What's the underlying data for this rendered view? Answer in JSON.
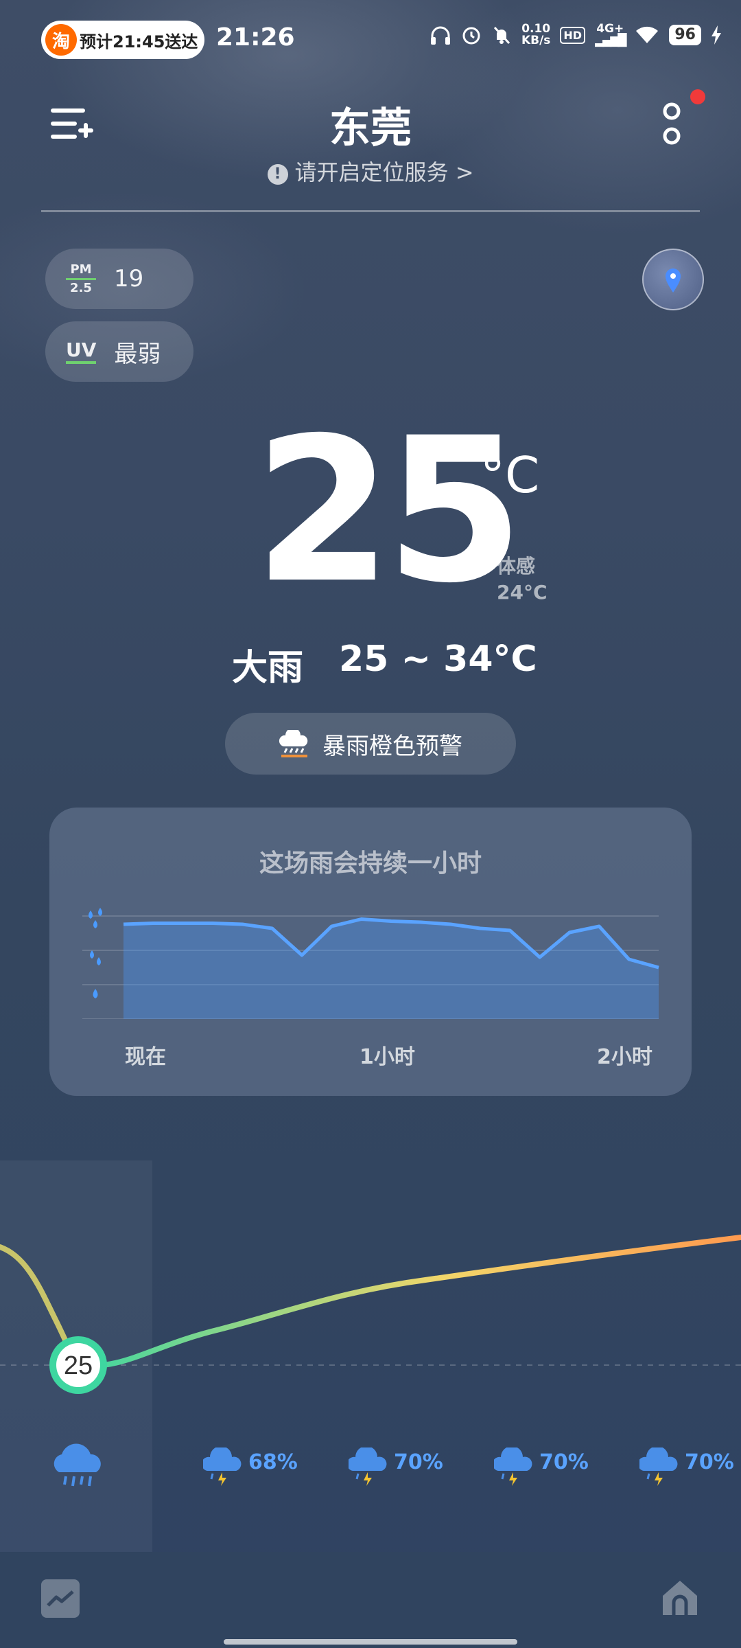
{
  "status_bar": {
    "order_pill_icon": "淘",
    "order_pill_text": "预计21:45送达",
    "time": "21:26",
    "net_speed_value": "0.10",
    "net_speed_unit": "KB/s",
    "hd_badge": "HD",
    "network": "4G+",
    "battery": "96",
    "icons": [
      "headphones-icon",
      "alarm-icon",
      "mute-bell-icon",
      "signal-icon",
      "wifi-icon",
      "charging-icon"
    ]
  },
  "header": {
    "city": "东莞",
    "location_hint": "请开启定位服务",
    "location_hint_arrow": ">",
    "exclamation": "!"
  },
  "aqi": {
    "pm_label_top": "PM",
    "pm_label_bottom": "2.5",
    "pm_value": "19",
    "uv_label": "UV",
    "uv_value": "最弱"
  },
  "current": {
    "temperature": "25",
    "unit": "°C",
    "feels_label": "体感",
    "feels_value": "24°C",
    "condition": "大雨",
    "range": "25 ~ 34°C"
  },
  "alert": {
    "text": "暴雨橙色预警",
    "color": "#f0913a"
  },
  "rain_card": {
    "title": "这场雨会持续一小时",
    "axis_labels": [
      "现在",
      "1小时",
      "2小时"
    ],
    "intensity_levels": [
      0.92,
      0.93,
      0.93,
      0.93,
      0.92,
      0.88,
      0.62,
      0.9,
      0.97,
      0.95,
      0.94,
      0.92,
      0.88,
      0.86,
      0.6,
      0.84,
      0.9,
      0.58,
      0.5
    ]
  },
  "hourly": {
    "current_temp": "25",
    "probabilities": [
      "68%",
      "70%",
      "70%",
      "70%"
    ],
    "colors": {
      "rain_prob": "#5aa3ff",
      "curve_cool": "#3ed6a0",
      "curve_mid": "#f2d66a",
      "curve_warm": "#ff9a4f"
    }
  }
}
